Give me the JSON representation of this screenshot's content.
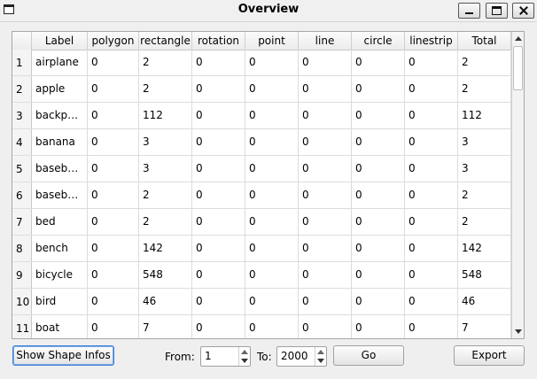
{
  "window": {
    "title": "Overview"
  },
  "table": {
    "columns": [
      "Label",
      "polygon",
      "rectangle",
      "rotation",
      "point",
      "line",
      "circle",
      "linestrip",
      "Total"
    ],
    "rows": [
      {
        "index": "1",
        "cells": [
          "airplane",
          "0",
          "2",
          "0",
          "0",
          "0",
          "0",
          "0",
          "2"
        ]
      },
      {
        "index": "2",
        "cells": [
          "apple",
          "0",
          "2",
          "0",
          "0",
          "0",
          "0",
          "0",
          "2"
        ]
      },
      {
        "index": "3",
        "cells": [
          "backp…",
          "0",
          "112",
          "0",
          "0",
          "0",
          "0",
          "0",
          "112"
        ]
      },
      {
        "index": "4",
        "cells": [
          "banana",
          "0",
          "3",
          "0",
          "0",
          "0",
          "0",
          "0",
          "3"
        ]
      },
      {
        "index": "5",
        "cells": [
          "baseb…",
          "0",
          "3",
          "0",
          "0",
          "0",
          "0",
          "0",
          "3"
        ]
      },
      {
        "index": "6",
        "cells": [
          "baseb…",
          "0",
          "2",
          "0",
          "0",
          "0",
          "0",
          "0",
          "2"
        ]
      },
      {
        "index": "7",
        "cells": [
          "bed",
          "0",
          "2",
          "0",
          "0",
          "0",
          "0",
          "0",
          "2"
        ]
      },
      {
        "index": "8",
        "cells": [
          "bench",
          "0",
          "142",
          "0",
          "0",
          "0",
          "0",
          "0",
          "142"
        ]
      },
      {
        "index": "9",
        "cells": [
          "bicycle",
          "0",
          "548",
          "0",
          "0",
          "0",
          "0",
          "0",
          "548"
        ]
      },
      {
        "index": "10",
        "cells": [
          "bird",
          "0",
          "46",
          "0",
          "0",
          "0",
          "0",
          "0",
          "46"
        ]
      },
      {
        "index": "11",
        "cells": [
          "boat",
          "0",
          "7",
          "0",
          "0",
          "0",
          "0",
          "0",
          "7"
        ]
      }
    ]
  },
  "footer": {
    "show_shape_infos": "Show Shape Infos",
    "from_label": "From:",
    "from_value": "1",
    "to_label": "To:",
    "to_value": "2000",
    "go": "Go",
    "export": "Export"
  }
}
